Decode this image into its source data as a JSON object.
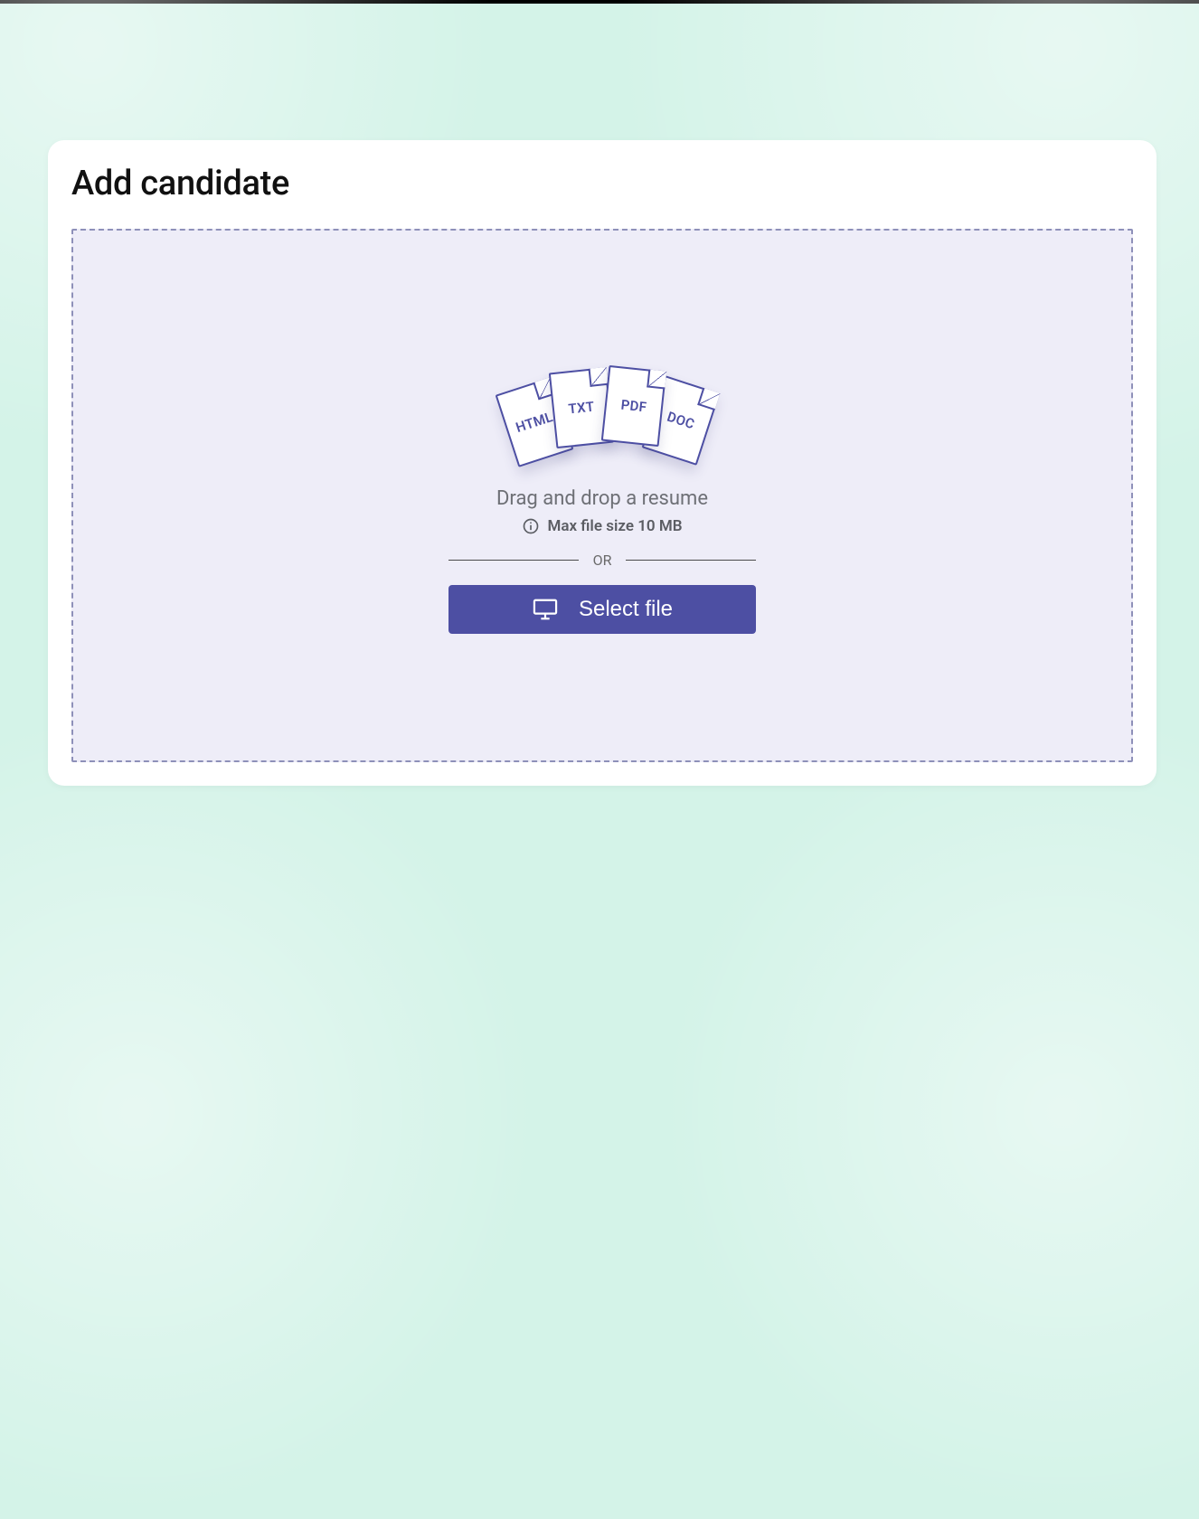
{
  "card": {
    "title": "Add candidate"
  },
  "dropzone": {
    "file_types": [
      "HTML",
      "TXT",
      "PDF",
      "DOC"
    ],
    "drag_text": "Drag and drop a resume",
    "hint_text": "Max file size 10 MB",
    "or_label": "OR",
    "select_button_label": "Select file"
  },
  "colors": {
    "accent": "#4d4fa3",
    "bg": "#d4f3e8",
    "dropzone_bg": "#eeedf8"
  }
}
